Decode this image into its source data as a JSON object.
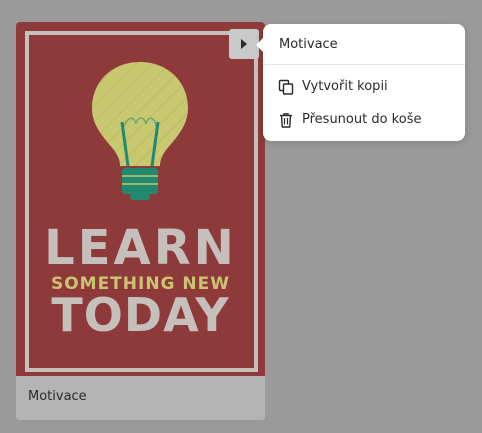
{
  "card": {
    "title": "Motivace",
    "poster": {
      "line1": "LEARN",
      "line2": "SOMETHING NEW",
      "line3": "TODAY",
      "background_color": "#8e3a3a",
      "text_color": "#c6c0bc",
      "accent_color": "#cbc372",
      "bulb_color": "#c7c86f",
      "bulb_base_color": "#1f8a6f"
    }
  },
  "menu": {
    "title": "Motivace",
    "items": [
      {
        "label": "Vytvořit kopii",
        "icon": "copy-icon"
      },
      {
        "label": "Přesunout do koše",
        "icon": "trash-icon"
      }
    ]
  },
  "toggle": {
    "icon": "caret-right-icon"
  }
}
